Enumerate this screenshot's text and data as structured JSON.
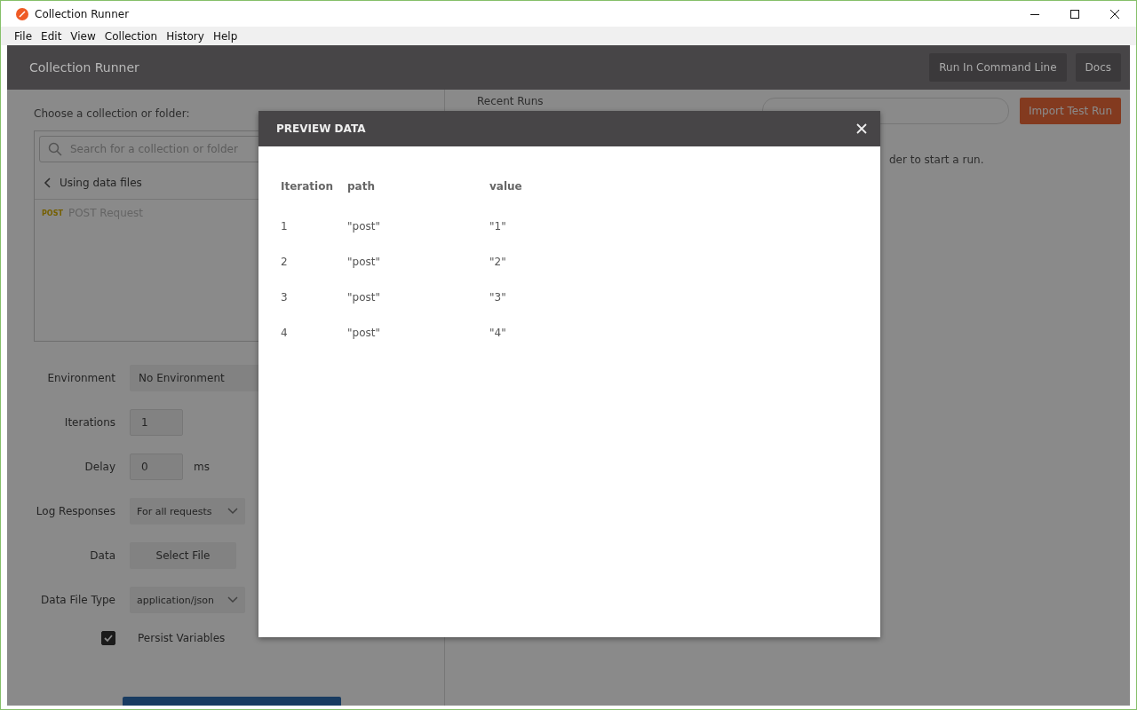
{
  "window": {
    "title": "Collection Runner"
  },
  "menu": [
    "File",
    "Edit",
    "View",
    "Collection",
    "History",
    "Help"
  ],
  "header": {
    "title": "Collection Runner",
    "buttons": [
      "Run In Command Line",
      "Docs"
    ]
  },
  "collection_picker": {
    "label": "Choose a collection or folder:",
    "search": {
      "placeholder": "Search for a collection or folder"
    },
    "back_label": "Using data files",
    "requests": [
      {
        "method": "POST",
        "name": "POST Request"
      }
    ]
  },
  "settings": [
    {
      "kind": "select",
      "label": "Environment",
      "value": "No Environment"
    },
    {
      "kind": "input",
      "label": "Iterations",
      "value": "1"
    },
    {
      "kind": "input",
      "label": "Delay",
      "value": "0",
      "unit": "ms"
    },
    {
      "kind": "dropdown",
      "label": "Log Responses",
      "value": "For all requests"
    },
    {
      "kind": "file",
      "label": "Data",
      "button": "Select File"
    },
    {
      "kind": "dropdown",
      "label": "Data File Type",
      "value": "application/json"
    },
    {
      "kind": "checkbox",
      "label": "Persist Variables",
      "checked": true
    }
  ],
  "recent_runs": {
    "title": "Recent Runs",
    "import_button": "Import Test Run",
    "empty_message": "der to start a run."
  },
  "preview": {
    "title": "PREVIEW DATA",
    "columns": [
      "Iteration",
      "path",
      "value"
    ],
    "rows": [
      [
        "1",
        "\"post\"",
        "\"1\""
      ],
      [
        "2",
        "\"post\"",
        "\"2\""
      ],
      [
        "3",
        "\"post\"",
        "\"3\""
      ],
      [
        "4",
        "\"post\"",
        "\"4\""
      ]
    ]
  }
}
